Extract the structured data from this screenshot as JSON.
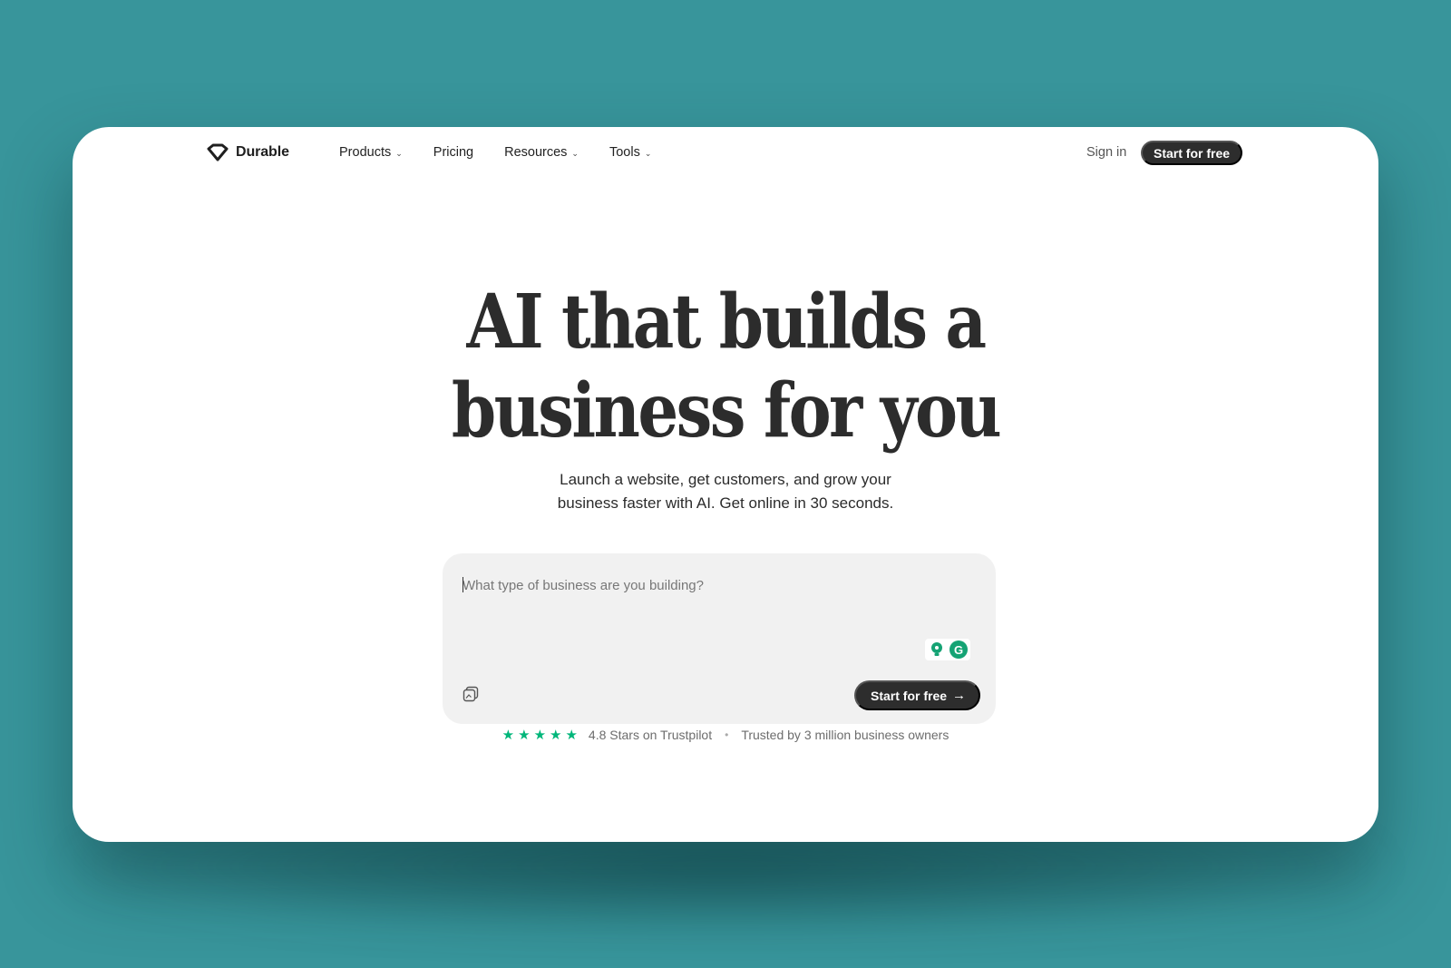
{
  "brand": {
    "name": "Durable",
    "logo_icon": "diamond-logo-icon"
  },
  "nav": {
    "links": [
      {
        "label": "Products",
        "has_dropdown": true
      },
      {
        "label": "Pricing",
        "has_dropdown": false
      },
      {
        "label": "Resources",
        "has_dropdown": true
      },
      {
        "label": "Tools",
        "has_dropdown": true
      }
    ],
    "chevron": "⌄",
    "sign_in": "Sign in",
    "cta": "Start for free"
  },
  "hero": {
    "title_line1": "AI that builds a",
    "title_line2": "business for you",
    "subtitle_line1": "Launch a website, get customers, and grow your",
    "subtitle_line2": "business faster with AI. Get online in 30 seconds."
  },
  "prompt": {
    "placeholder": "What type of business are you building?",
    "value": "",
    "cta": "Start for free",
    "cta_icon": "arrow-right-icon",
    "grammarly_letter": "G"
  },
  "trust": {
    "rating_value": 4.8,
    "stars_count": 5,
    "rating_text": "4.8 Stars on Trustpilot",
    "separator": "•",
    "trusted_text": "Trusted by 3 million business owners"
  },
  "colors": {
    "background": "#38959b",
    "dark_button": "#2d2d2d",
    "star_green": "#00b67a",
    "grammarly_green": "#15a374",
    "prompt_bg": "#f1f1f1"
  }
}
